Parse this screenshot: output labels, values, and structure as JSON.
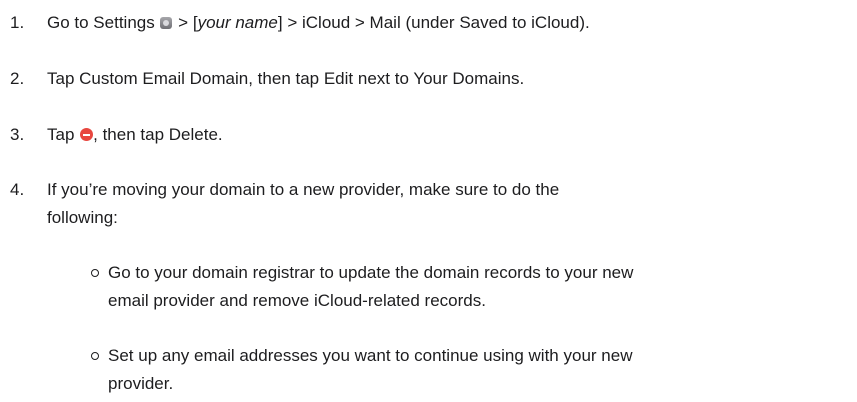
{
  "steps": [
    {
      "number": "1.",
      "prefix": "Go to Settings ",
      "icon": "settings-gear-icon",
      "middle": " > [",
      "emphasis": "your name",
      "suffix": "] > iCloud > Mail (under Saved to iCloud)."
    },
    {
      "number": "2.",
      "text": "Tap Custom Email Domain, then tap Edit next to Your Domains."
    },
    {
      "number": "3.",
      "prefix": "Tap ",
      "icon": "delete-icon",
      "suffix": ", then tap Delete."
    },
    {
      "number": "4.",
      "line1": "If you’re moving your domain to a new provider, make sure to do the",
      "line2": "following:"
    }
  ],
  "sub_items": [
    {
      "line1": "Go to your domain registrar to update the domain records to your new",
      "line2": "email provider and remove iCloud-related records."
    },
    {
      "line1": "Set up any email addresses you want to continue using with your new",
      "line2": "provider."
    }
  ],
  "colors": {
    "text": "#1d1d1f",
    "delete_icon": "#e8473f",
    "settings_icon": "#8e8e93"
  }
}
